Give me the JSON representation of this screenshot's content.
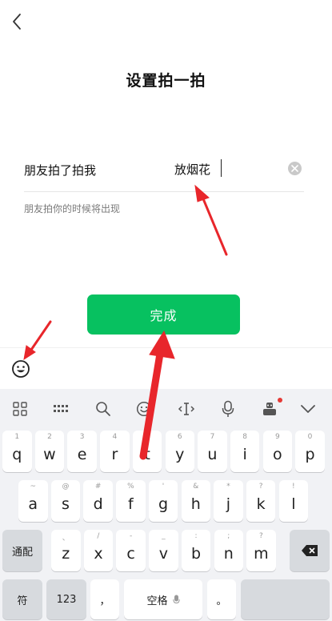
{
  "header": {
    "back_icon": "chevron-left-icon",
    "title": "设置拍一拍"
  },
  "form": {
    "prefix": "朋友拍了拍我",
    "value": "放烟花",
    "hint": "朋友拍你的时候将出现",
    "clear_icon": "clear-circle-icon"
  },
  "done_button": {
    "label": "完成",
    "color": "#07c160"
  },
  "emoji_bar": {
    "icon": "smiley-face-icon"
  },
  "keyboard": {
    "toolbar_icons": [
      "grid-icon",
      "keyboard-icon",
      "search-icon",
      "smiley-icon",
      "cursor-move-icon",
      "microphone-icon",
      "robot-skin-icon",
      "chevron-down-icon"
    ],
    "row1": [
      {
        "key": "q",
        "sub": "1"
      },
      {
        "key": "w",
        "sub": "2"
      },
      {
        "key": "e",
        "sub": "3"
      },
      {
        "key": "r",
        "sub": "4"
      },
      {
        "key": "t",
        "sub": "5"
      },
      {
        "key": "y",
        "sub": "6"
      },
      {
        "key": "u",
        "sub": "7"
      },
      {
        "key": "i",
        "sub": "8"
      },
      {
        "key": "o",
        "sub": "9"
      },
      {
        "key": "p",
        "sub": "0"
      }
    ],
    "row2": [
      {
        "key": "a",
        "sub": "~"
      },
      {
        "key": "s",
        "sub": "@"
      },
      {
        "key": "d",
        "sub": "#"
      },
      {
        "key": "f",
        "sub": "%"
      },
      {
        "key": "g",
        "sub": "'"
      },
      {
        "key": "h",
        "sub": "&"
      },
      {
        "key": "j",
        "sub": "*"
      },
      {
        "key": "k",
        "sub": "?"
      },
      {
        "key": "l",
        "sub": "!"
      }
    ],
    "row3": [
      {
        "key": "z",
        "sub": "、"
      },
      {
        "key": "x",
        "sub": "/"
      },
      {
        "key": "c",
        "sub": "-"
      },
      {
        "key": "v",
        "sub": "_"
      },
      {
        "key": "b",
        "sub": ":"
      },
      {
        "key": "n",
        "sub": ";"
      },
      {
        "key": "m",
        "sub": "?"
      }
    ],
    "fn_label": "通配",
    "backspace_icon": "backspace-icon",
    "symbol_label": "符",
    "num_label": "123",
    "comma_label": "，",
    "space_label": "空格",
    "period_label": "。"
  },
  "colors": {
    "accent": "#07c160",
    "annotation_arrow": "#e8262b",
    "notification_dot": "#e53935"
  }
}
